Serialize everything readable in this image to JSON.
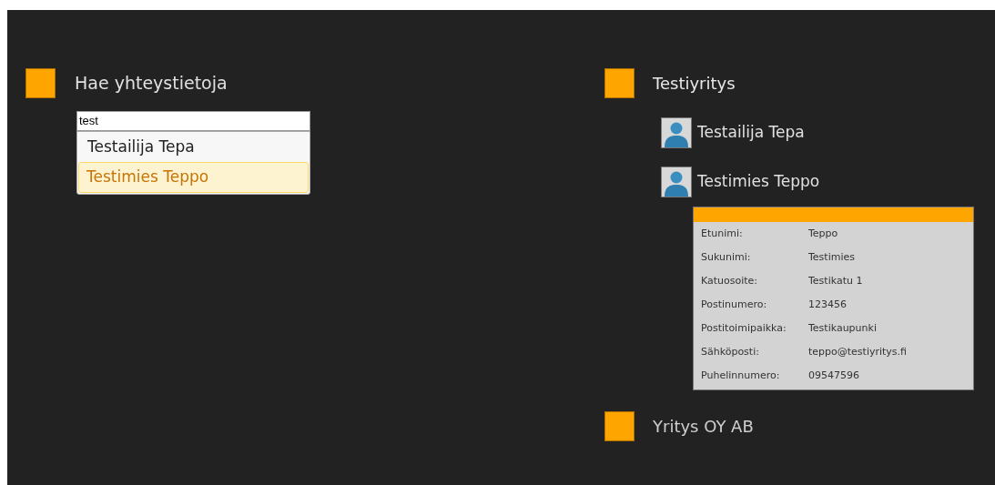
{
  "search": {
    "title": "Hae yhteystietoja",
    "value": "test",
    "suggestions": [
      {
        "label": "Testailija Tepa",
        "selected": false
      },
      {
        "label": "Testimies Teppo",
        "selected": true
      }
    ]
  },
  "companies": [
    {
      "name": "Testiyritys",
      "expanded": true,
      "contacts": [
        {
          "name": "Testailija Tepa",
          "expanded": false
        },
        {
          "name": "Testimies Teppo",
          "expanded": true,
          "details": [
            {
              "label": "Etunimi:",
              "value": "Teppo"
            },
            {
              "label": "Sukunimi:",
              "value": "Testimies"
            },
            {
              "label": "Katuosoite:",
              "value": "Testikatu 1"
            },
            {
              "label": "Postinumero:",
              "value": "123456"
            },
            {
              "label": "Postitoimipaikka:",
              "value": "Testikaupunki"
            },
            {
              "label": "Sähköposti:",
              "value": "teppo@testiyritys.fi"
            },
            {
              "label": "Puhelinnumero:",
              "value": "09547596"
            }
          ]
        }
      ]
    },
    {
      "name": "Yritys OY AB",
      "expanded": false
    }
  ]
}
